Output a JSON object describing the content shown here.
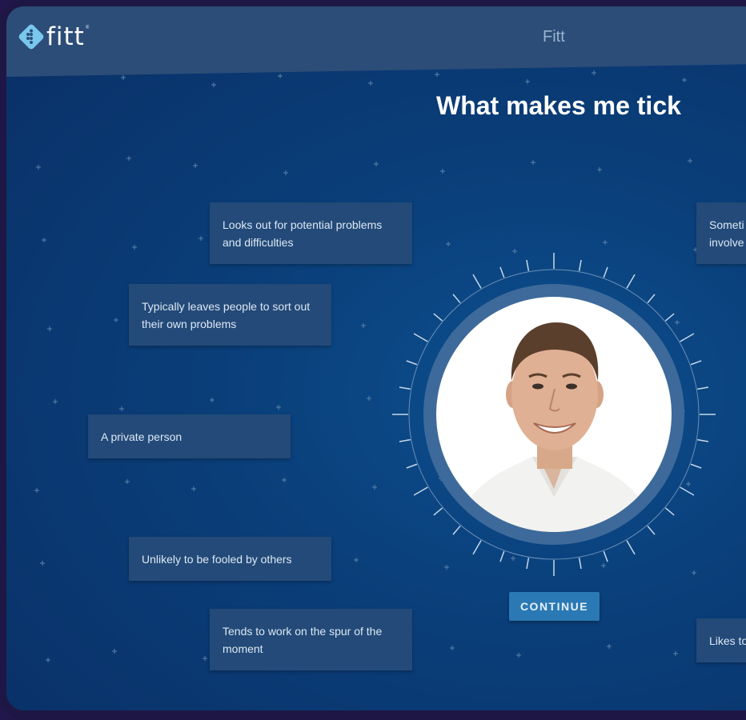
{
  "app": {
    "logo_text": "fitt",
    "logo_mark": "®",
    "title": "Fitt"
  },
  "page": {
    "heading": "What makes me tick"
  },
  "cards": [
    {
      "text": "Looks out for potential problems and difficulties"
    },
    {
      "text": "Typically leaves people to sort out their own problems"
    },
    {
      "text": "A private person"
    },
    {
      "text": "Unlikely to be fooled by others"
    },
    {
      "text": "Tends to work on the spur of the moment"
    },
    {
      "text": "Someti involve"
    },
    {
      "text": "Likes to"
    }
  ],
  "actions": {
    "continue_label": "CONTINUE"
  },
  "icons": {
    "logo": "diamond-dots-logo-icon",
    "portrait": "person-portrait"
  },
  "colors": {
    "background": "#0a3f7a",
    "card": "#234a78",
    "button": "#2a79b4",
    "ring": "#3d6a9a",
    "topbar": "#2c4d78"
  }
}
